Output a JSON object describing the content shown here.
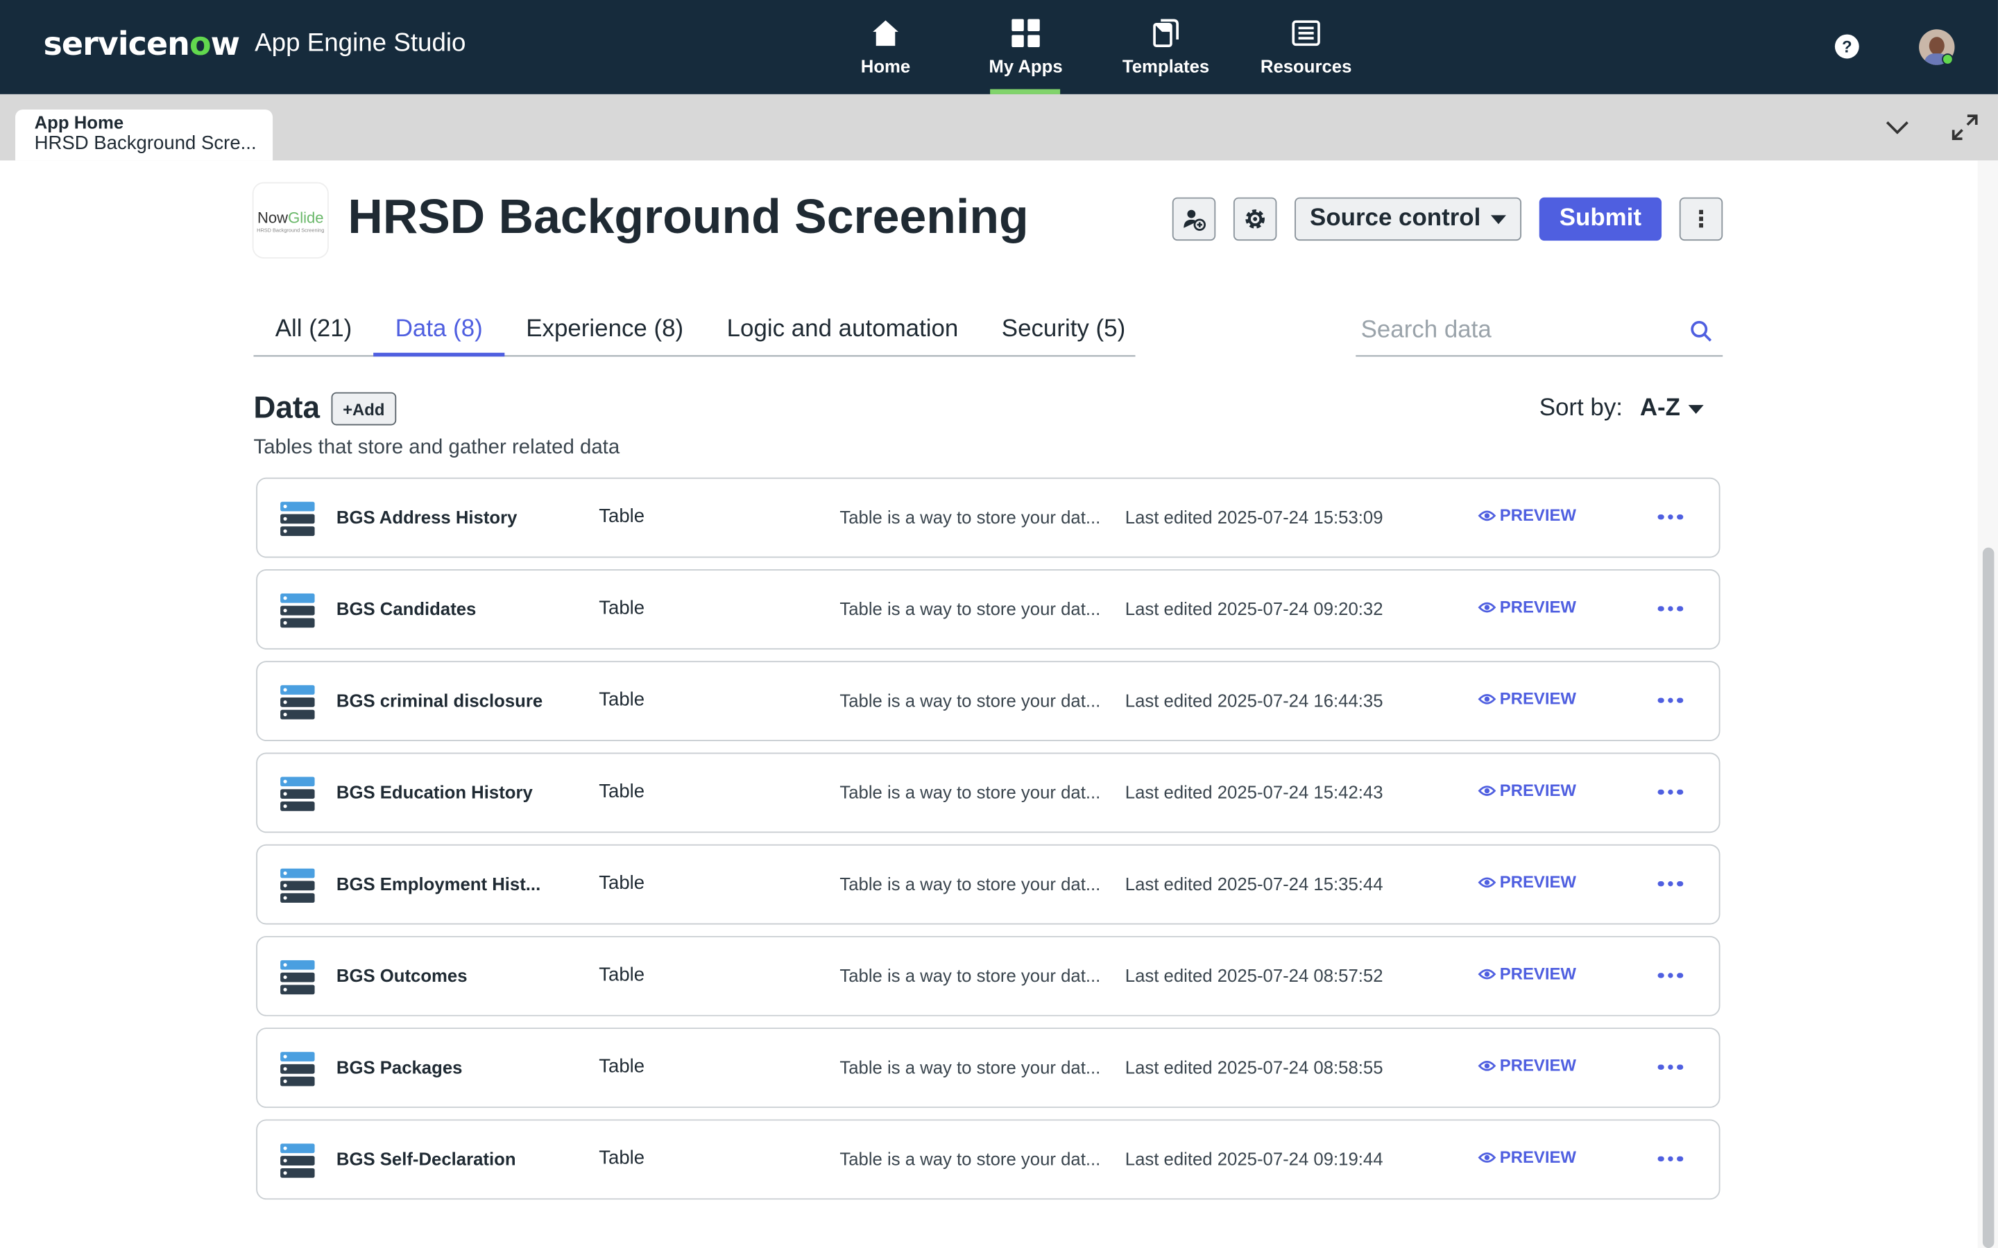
{
  "topnav": {
    "brand": {
      "logo_pre": "servicen",
      "logo_o": "o",
      "logo_post": "w",
      "app_name": "App Engine Studio"
    },
    "items": [
      {
        "label": "Home",
        "icon": "home-icon"
      },
      {
        "label": "My Apps",
        "icon": "grid-icon",
        "active": true
      },
      {
        "label": "Templates",
        "icon": "templates-icon"
      },
      {
        "label": "Resources",
        "icon": "resources-icon"
      }
    ],
    "help": "?",
    "accent_color": "#81d46b",
    "background_color": "#162b3c"
  },
  "tabstrip": {
    "tab_line1": "App Home",
    "tab_line2": "HRSD Background Scre..."
  },
  "header": {
    "logo_now": "Now",
    "logo_glide": "Glide",
    "logo_sub": "HRSD Background Screening",
    "title": "HRSD Background Screening",
    "source_control": "Source control",
    "submit": "Submit",
    "more": "⋮",
    "submit_color": "#4f5fe0"
  },
  "tabs": [
    {
      "label": "All (21)"
    },
    {
      "label": "Data (8)",
      "active": true
    },
    {
      "label": "Experience (8)"
    },
    {
      "label": "Logic and automation"
    },
    {
      "label": "Security (5)"
    }
  ],
  "search": {
    "placeholder": "Search data",
    "value": ""
  },
  "section": {
    "title": "Data",
    "add": "+Add",
    "description": "Tables that store and gather related data",
    "sort_label": "Sort by:",
    "sort_value": "A-Z"
  },
  "rows": [
    {
      "name": "BGS Address History",
      "type": "Table",
      "desc": "Table is a way to store your dat...",
      "edited": "Last edited 2025-07-24 15:53:09",
      "preview": "PREVIEW"
    },
    {
      "name": "BGS Candidates",
      "type": "Table",
      "desc": "Table is a way to store your dat...",
      "edited": "Last edited 2025-07-24 09:20:32",
      "preview": "PREVIEW"
    },
    {
      "name": "BGS criminal disclosure",
      "type": "Table",
      "desc": "Table is a way to store your dat...",
      "edited": "Last edited 2025-07-24 16:44:35",
      "preview": "PREVIEW"
    },
    {
      "name": "BGS Education History",
      "type": "Table",
      "desc": "Table is a way to store your dat...",
      "edited": "Last edited 2025-07-24 15:42:43",
      "preview": "PREVIEW"
    },
    {
      "name": "BGS Employment Hist...",
      "type": "Table",
      "desc": "Table is a way to store your dat...",
      "edited": "Last edited 2025-07-24 15:35:44",
      "preview": "PREVIEW"
    },
    {
      "name": "BGS Outcomes",
      "type": "Table",
      "desc": "Table is a way to store your dat...",
      "edited": "Last edited 2025-07-24 08:57:52",
      "preview": "PREVIEW"
    },
    {
      "name": "BGS Packages",
      "type": "Table",
      "desc": "Table is a way to store your dat...",
      "edited": "Last edited 2025-07-24 08:58:55",
      "preview": "PREVIEW"
    },
    {
      "name": "BGS Self-Declaration",
      "type": "Table",
      "desc": "Table is a way to store your dat...",
      "edited": "Last edited 2025-07-24 09:19:44",
      "preview": "PREVIEW"
    }
  ]
}
